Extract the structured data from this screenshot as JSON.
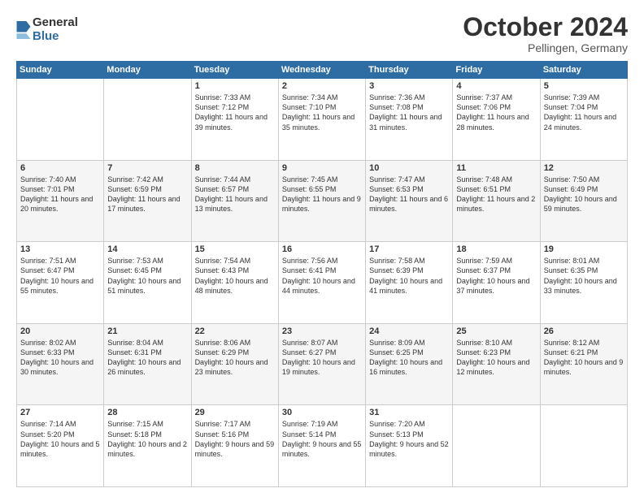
{
  "logo": {
    "general": "General",
    "blue": "Blue"
  },
  "title": "October 2024",
  "location": "Pellingen, Germany",
  "days_header": [
    "Sunday",
    "Monday",
    "Tuesday",
    "Wednesday",
    "Thursday",
    "Friday",
    "Saturday"
  ],
  "weeks": [
    [
      {
        "day": "",
        "sunrise": "",
        "sunset": "",
        "daylight": ""
      },
      {
        "day": "",
        "sunrise": "",
        "sunset": "",
        "daylight": ""
      },
      {
        "day": "1",
        "sunrise": "Sunrise: 7:33 AM",
        "sunset": "Sunset: 7:12 PM",
        "daylight": "Daylight: 11 hours and 39 minutes."
      },
      {
        "day": "2",
        "sunrise": "Sunrise: 7:34 AM",
        "sunset": "Sunset: 7:10 PM",
        "daylight": "Daylight: 11 hours and 35 minutes."
      },
      {
        "day": "3",
        "sunrise": "Sunrise: 7:36 AM",
        "sunset": "Sunset: 7:08 PM",
        "daylight": "Daylight: 11 hours and 31 minutes."
      },
      {
        "day": "4",
        "sunrise": "Sunrise: 7:37 AM",
        "sunset": "Sunset: 7:06 PM",
        "daylight": "Daylight: 11 hours and 28 minutes."
      },
      {
        "day": "5",
        "sunrise": "Sunrise: 7:39 AM",
        "sunset": "Sunset: 7:04 PM",
        "daylight": "Daylight: 11 hours and 24 minutes."
      }
    ],
    [
      {
        "day": "6",
        "sunrise": "Sunrise: 7:40 AM",
        "sunset": "Sunset: 7:01 PM",
        "daylight": "Daylight: 11 hours and 20 minutes."
      },
      {
        "day": "7",
        "sunrise": "Sunrise: 7:42 AM",
        "sunset": "Sunset: 6:59 PM",
        "daylight": "Daylight: 11 hours and 17 minutes."
      },
      {
        "day": "8",
        "sunrise": "Sunrise: 7:44 AM",
        "sunset": "Sunset: 6:57 PM",
        "daylight": "Daylight: 11 hours and 13 minutes."
      },
      {
        "day": "9",
        "sunrise": "Sunrise: 7:45 AM",
        "sunset": "Sunset: 6:55 PM",
        "daylight": "Daylight: 11 hours and 9 minutes."
      },
      {
        "day": "10",
        "sunrise": "Sunrise: 7:47 AM",
        "sunset": "Sunset: 6:53 PM",
        "daylight": "Daylight: 11 hours and 6 minutes."
      },
      {
        "day": "11",
        "sunrise": "Sunrise: 7:48 AM",
        "sunset": "Sunset: 6:51 PM",
        "daylight": "Daylight: 11 hours and 2 minutes."
      },
      {
        "day": "12",
        "sunrise": "Sunrise: 7:50 AM",
        "sunset": "Sunset: 6:49 PM",
        "daylight": "Daylight: 10 hours and 59 minutes."
      }
    ],
    [
      {
        "day": "13",
        "sunrise": "Sunrise: 7:51 AM",
        "sunset": "Sunset: 6:47 PM",
        "daylight": "Daylight: 10 hours and 55 minutes."
      },
      {
        "day": "14",
        "sunrise": "Sunrise: 7:53 AM",
        "sunset": "Sunset: 6:45 PM",
        "daylight": "Daylight: 10 hours and 51 minutes."
      },
      {
        "day": "15",
        "sunrise": "Sunrise: 7:54 AM",
        "sunset": "Sunset: 6:43 PM",
        "daylight": "Daylight: 10 hours and 48 minutes."
      },
      {
        "day": "16",
        "sunrise": "Sunrise: 7:56 AM",
        "sunset": "Sunset: 6:41 PM",
        "daylight": "Daylight: 10 hours and 44 minutes."
      },
      {
        "day": "17",
        "sunrise": "Sunrise: 7:58 AM",
        "sunset": "Sunset: 6:39 PM",
        "daylight": "Daylight: 10 hours and 41 minutes."
      },
      {
        "day": "18",
        "sunrise": "Sunrise: 7:59 AM",
        "sunset": "Sunset: 6:37 PM",
        "daylight": "Daylight: 10 hours and 37 minutes."
      },
      {
        "day": "19",
        "sunrise": "Sunrise: 8:01 AM",
        "sunset": "Sunset: 6:35 PM",
        "daylight": "Daylight: 10 hours and 33 minutes."
      }
    ],
    [
      {
        "day": "20",
        "sunrise": "Sunrise: 8:02 AM",
        "sunset": "Sunset: 6:33 PM",
        "daylight": "Daylight: 10 hours and 30 minutes."
      },
      {
        "day": "21",
        "sunrise": "Sunrise: 8:04 AM",
        "sunset": "Sunset: 6:31 PM",
        "daylight": "Daylight: 10 hours and 26 minutes."
      },
      {
        "day": "22",
        "sunrise": "Sunrise: 8:06 AM",
        "sunset": "Sunset: 6:29 PM",
        "daylight": "Daylight: 10 hours and 23 minutes."
      },
      {
        "day": "23",
        "sunrise": "Sunrise: 8:07 AM",
        "sunset": "Sunset: 6:27 PM",
        "daylight": "Daylight: 10 hours and 19 minutes."
      },
      {
        "day": "24",
        "sunrise": "Sunrise: 8:09 AM",
        "sunset": "Sunset: 6:25 PM",
        "daylight": "Daylight: 10 hours and 16 minutes."
      },
      {
        "day": "25",
        "sunrise": "Sunrise: 8:10 AM",
        "sunset": "Sunset: 6:23 PM",
        "daylight": "Daylight: 10 hours and 12 minutes."
      },
      {
        "day": "26",
        "sunrise": "Sunrise: 8:12 AM",
        "sunset": "Sunset: 6:21 PM",
        "daylight": "Daylight: 10 hours and 9 minutes."
      }
    ],
    [
      {
        "day": "27",
        "sunrise": "Sunrise: 7:14 AM",
        "sunset": "Sunset: 5:20 PM",
        "daylight": "Daylight: 10 hours and 5 minutes."
      },
      {
        "day": "28",
        "sunrise": "Sunrise: 7:15 AM",
        "sunset": "Sunset: 5:18 PM",
        "daylight": "Daylight: 10 hours and 2 minutes."
      },
      {
        "day": "29",
        "sunrise": "Sunrise: 7:17 AM",
        "sunset": "Sunset: 5:16 PM",
        "daylight": "Daylight: 9 hours and 59 minutes."
      },
      {
        "day": "30",
        "sunrise": "Sunrise: 7:19 AM",
        "sunset": "Sunset: 5:14 PM",
        "daylight": "Daylight: 9 hours and 55 minutes."
      },
      {
        "day": "31",
        "sunrise": "Sunrise: 7:20 AM",
        "sunset": "Sunset: 5:13 PM",
        "daylight": "Daylight: 9 hours and 52 minutes."
      },
      {
        "day": "",
        "sunrise": "",
        "sunset": "",
        "daylight": ""
      },
      {
        "day": "",
        "sunrise": "",
        "sunset": "",
        "daylight": ""
      }
    ]
  ]
}
